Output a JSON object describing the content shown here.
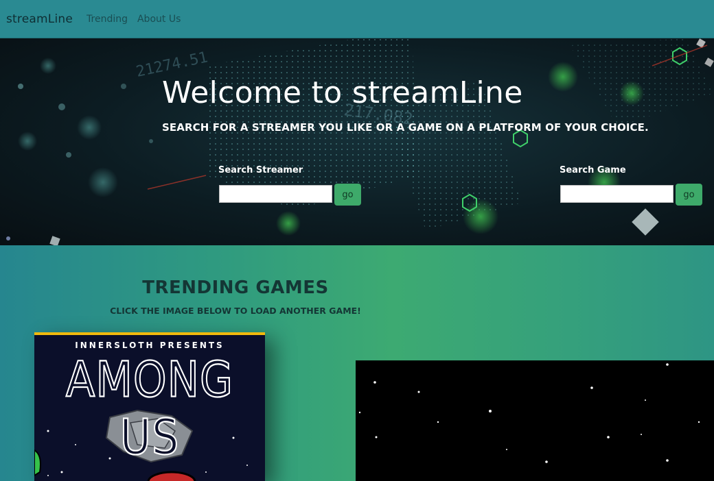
{
  "nav": {
    "brand": "streamLine",
    "links": [
      "Trending",
      "About Us"
    ]
  },
  "hero": {
    "title": "Welcome to streamLine",
    "subtitle": "SEARCH FOR A STREAMER YOU LIKE OR A GAME ON A PLATFORM OF YOUR CHOICE.",
    "search_streamer": {
      "label": "Search Streamer",
      "value": "",
      "button": "go"
    },
    "search_game": {
      "label": "Search Game",
      "value": "",
      "button": "go"
    }
  },
  "trending": {
    "title": "TRENDING GAMES",
    "subtitle": "CLICK THE IMAGE BELOW TO LOAD ANOTHER GAME!",
    "game_cover": {
      "presents": "INNERSLOTH PRESENTS",
      "title": "AMONG US"
    }
  },
  "colors": {
    "navbar": "#2a8a92",
    "button": "#3eaa6a",
    "cover_border": "#f1b90d",
    "text_dark": "#143635"
  }
}
